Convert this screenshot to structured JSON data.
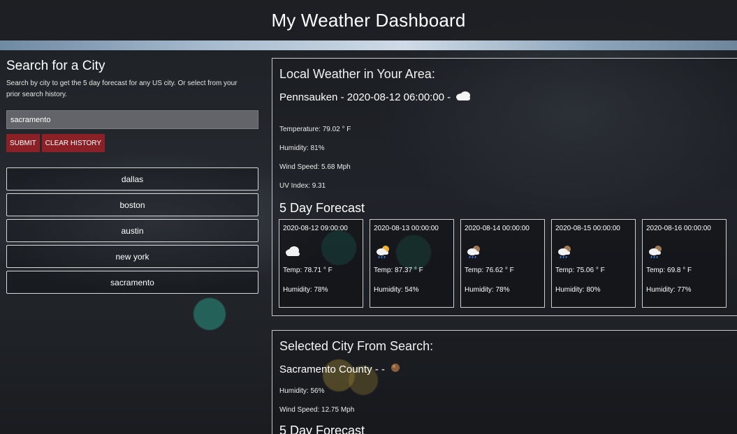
{
  "header": {
    "title": "My Weather Dashboard"
  },
  "search": {
    "title": "Search for a City",
    "description": "Search by city to get the 5 day forecast for any US city. Or select from your prior search history.",
    "input_value": "sacramento",
    "submit_label": "SUBMIT",
    "clear_label": "CLEAR HISTORY",
    "history": [
      "dallas",
      "boston",
      "austin",
      "new york",
      "sacramento"
    ]
  },
  "local": {
    "title": "Local Weather in Your Area:",
    "city_line": "Pennsauken - 2020-08-12 06:00:00 -",
    "icon": "cloud-icon",
    "temperature": "Temperature: 79.02 ° F",
    "humidity": "Humidity: 81%",
    "wind": "Wind Speed: 5.68 Mph",
    "uv": "UV Index: 9.31",
    "forecast_title": "5 Day Forecast",
    "forecast": [
      {
        "date": "2020-08-12 09:00:00",
        "icon": "cloud-icon",
        "temp": "Temp: 78.71 ° F",
        "humidity": "Humidity: 78%"
      },
      {
        "date": "2020-08-13 00:00:00",
        "icon": "sun-cloud-rain-icon",
        "temp": "Temp: 87.37 ° F",
        "humidity": "Humidity: 54%"
      },
      {
        "date": "2020-08-14 00:00:00",
        "icon": "moon-cloud-rain-icon",
        "temp": "Temp: 76.62 ° F",
        "humidity": "Humidity: 78%"
      },
      {
        "date": "2020-08-15 00:00:00",
        "icon": "moon-cloud-rain-icon",
        "temp": "Temp: 75.06 ° F",
        "humidity": "Humidity: 80%"
      },
      {
        "date": "2020-08-16 00:00:00",
        "icon": "moon-cloud-rain-icon",
        "temp": "Temp: 69.8 ° F",
        "humidity": "Humidity: 77%"
      }
    ]
  },
  "selected": {
    "title": "Selected City From Search:",
    "city_line": "Sacramento County - -",
    "icon": "moon-icon",
    "humidity": "Humidity: 56%",
    "wind": "Wind Speed: 12.75 Mph",
    "forecast_title": "5 Day Forecast"
  },
  "colors": {
    "button": "#8b2126",
    "header": "#1e2024"
  }
}
